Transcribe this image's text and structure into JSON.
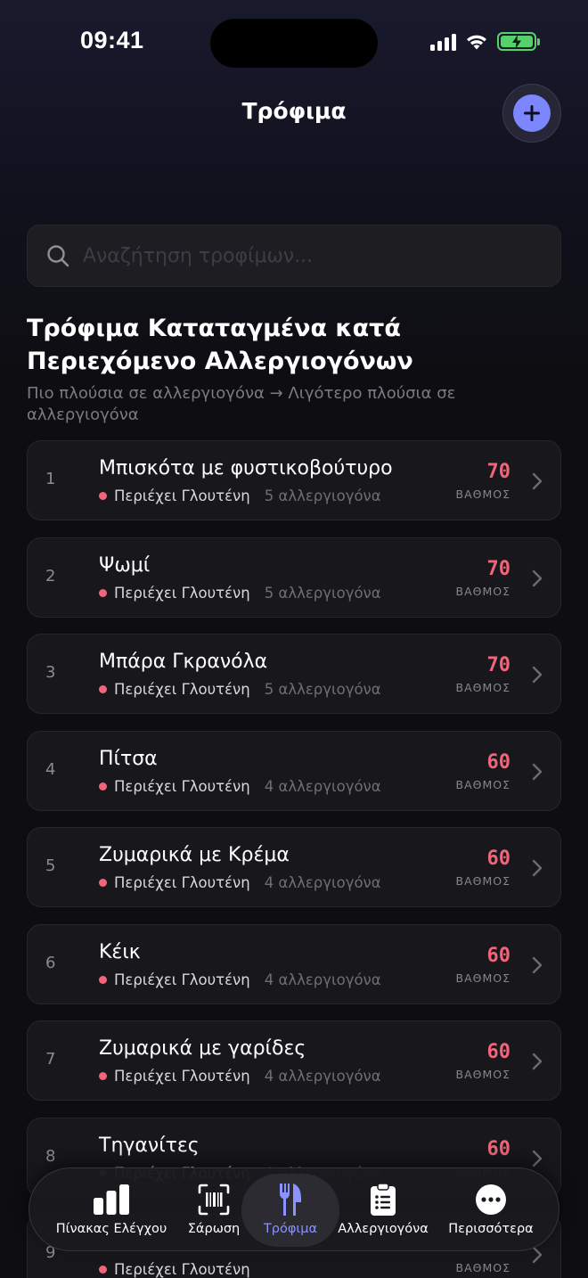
{
  "status_bar": {
    "time": "09:41"
  },
  "header": {
    "title": "Τρόφιμα"
  },
  "search": {
    "placeholder": "Αναζήτηση τροφίμων..."
  },
  "section": {
    "title": "Τρόφιμα Καταταγμένα κατά Περιεχόμενο Αλλεργιογόνων",
    "subtitle": "Πιο πλούσια σε αλλεργιογόνα → Λιγότερο πλούσια σε αλλεργιογόνα"
  },
  "score_label": "ΒΑΘΜΟΣ",
  "foods": [
    {
      "rank": "1",
      "name": "Μπισκότα με φυστικοβούτυρο",
      "tag": "Περιέχει Γλουτένη",
      "allergens": "5 αλλεργιογόνα",
      "score": "70"
    },
    {
      "rank": "2",
      "name": "Ψωμί",
      "tag": "Περιέχει Γλουτένη",
      "allergens": "5 αλλεργιογόνα",
      "score": "70"
    },
    {
      "rank": "3",
      "name": "Μπάρα Γκρανόλα",
      "tag": "Περιέχει Γλουτένη",
      "allergens": "5 αλλεργιογόνα",
      "score": "70"
    },
    {
      "rank": "4",
      "name": "Πίτσα",
      "tag": "Περιέχει Γλουτένη",
      "allergens": "4 αλλεργιογόνα",
      "score": "60"
    },
    {
      "rank": "5",
      "name": "Ζυμαρικά με Κρέμα",
      "tag": "Περιέχει Γλουτένη",
      "allergens": "4 αλλεργιογόνα",
      "score": "60"
    },
    {
      "rank": "6",
      "name": "Κέικ",
      "tag": "Περιέχει Γλουτένη",
      "allergens": "4 αλλεργιογόνα",
      "score": "60"
    },
    {
      "rank": "7",
      "name": "Ζυμαρικά με γαρίδες",
      "tag": "Περιέχει Γλουτένη",
      "allergens": "4 αλλεργιογόνα",
      "score": "60"
    },
    {
      "rank": "8",
      "name": "Τηγανίτες",
      "tag": "Περιέχει Γλουτένη",
      "allergens": "4 αλλεργιογόνα",
      "score": "60"
    },
    {
      "rank": "9",
      "name": "",
      "tag": "Περιέχει Γλουτένη",
      "allergens": "",
      "score": ""
    }
  ],
  "tabs": [
    {
      "label": "Πίνακας Ελέγχου",
      "icon": "chart-bars-icon"
    },
    {
      "label": "Σάρωση",
      "icon": "barcode-scan-icon"
    },
    {
      "label": "Τρόφιμα",
      "icon": "fork-knife-icon",
      "active": true
    },
    {
      "label": "Αλλεργιογόνα",
      "icon": "clipboard-list-icon"
    },
    {
      "label": "Περισσότερα",
      "icon": "more-dots-icon"
    }
  ],
  "colors": {
    "accent": "#8a93ff",
    "score": "#f2647a",
    "battery": "#55d16b"
  }
}
